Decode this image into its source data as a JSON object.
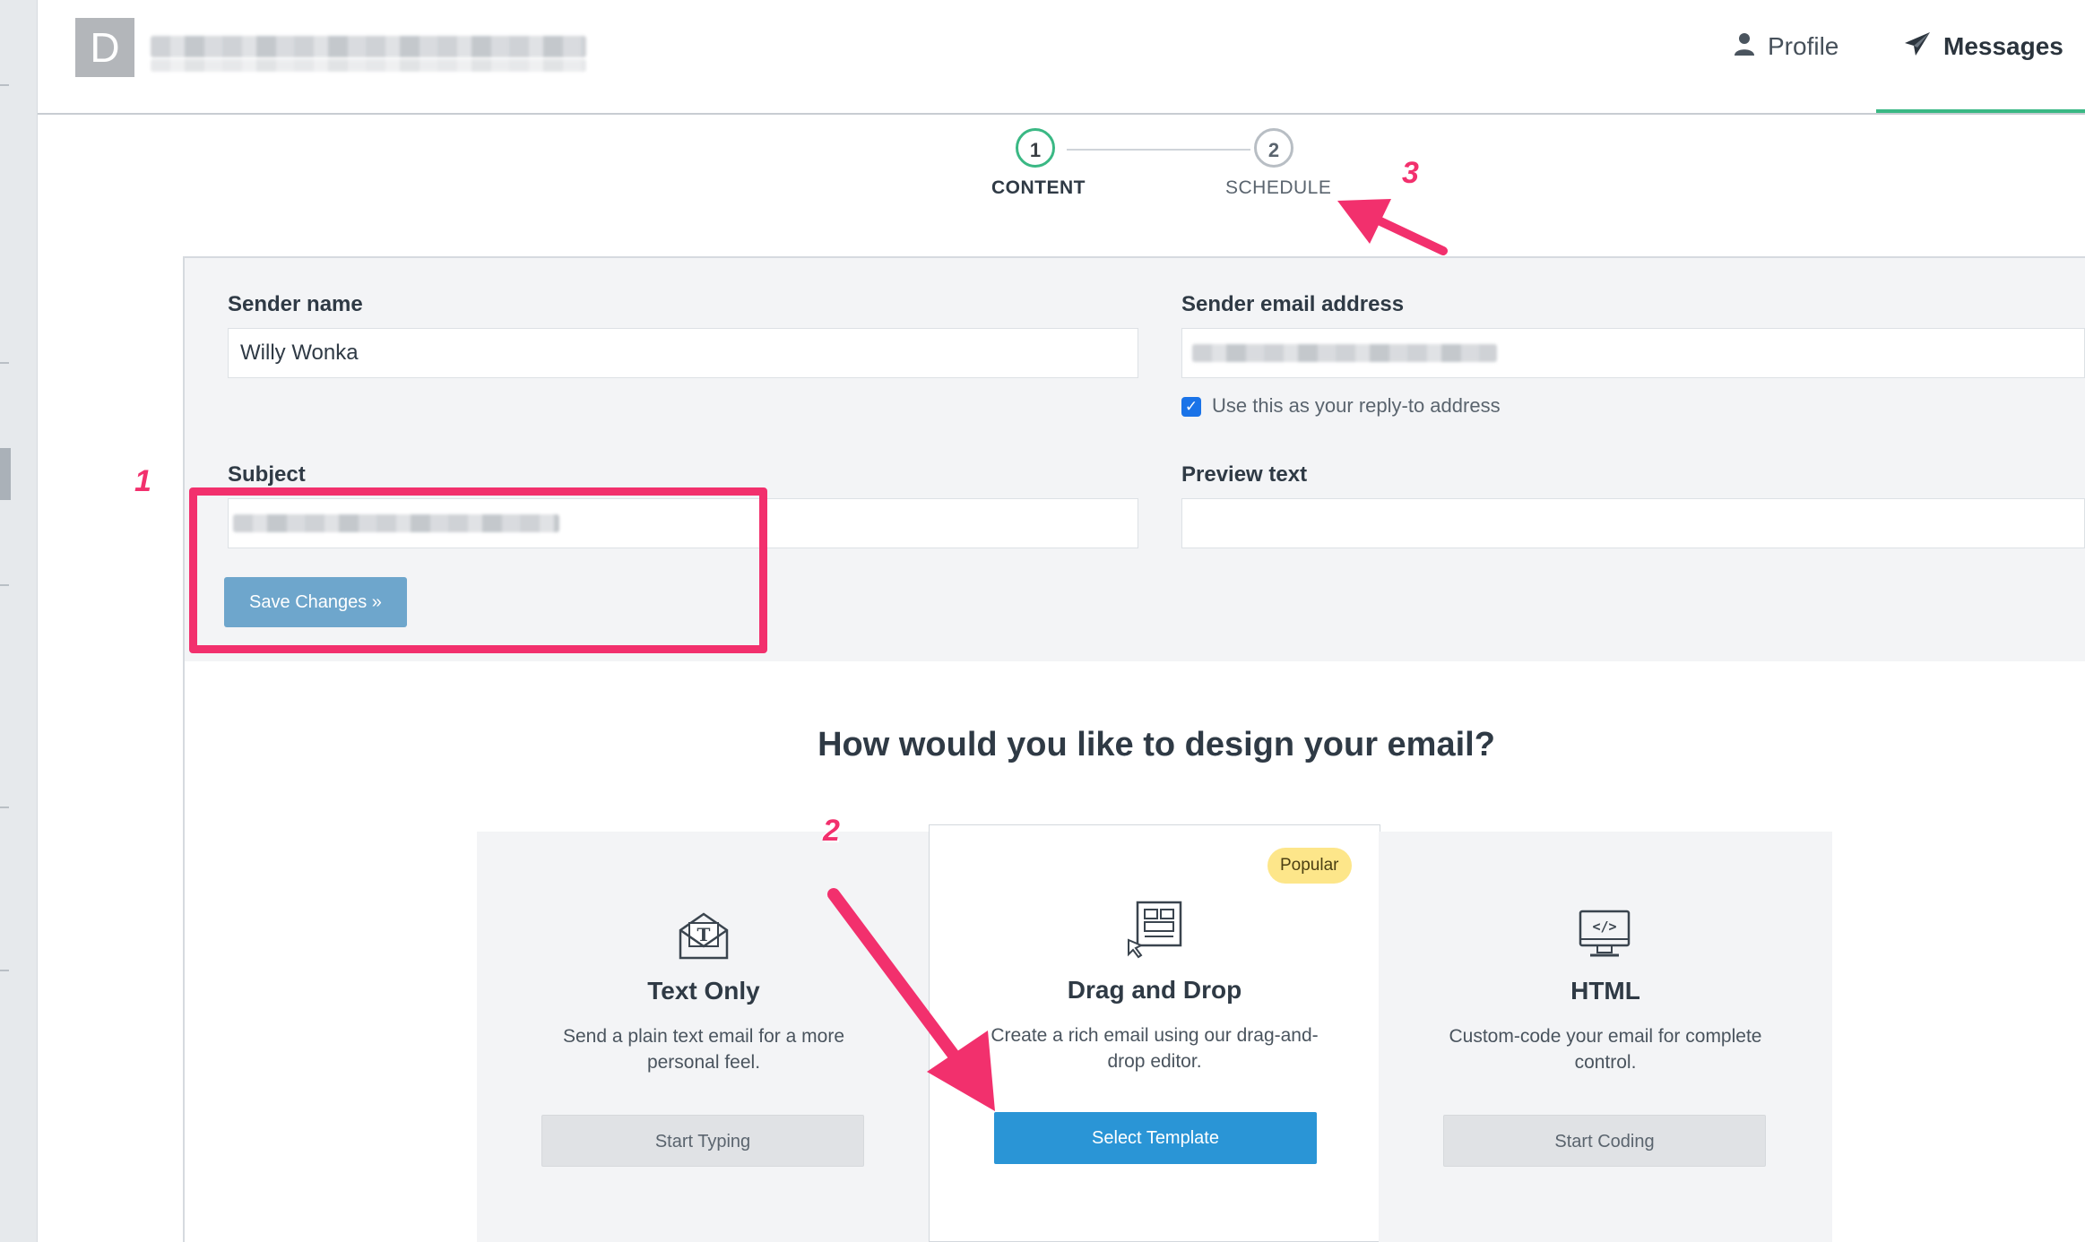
{
  "header": {
    "logo_letter": "D",
    "nav": [
      {
        "label": "Profile",
        "icon": "user-icon"
      },
      {
        "label": "Messages",
        "icon": "paper-plane-icon"
      }
    ]
  },
  "stepper": {
    "steps": [
      {
        "number": "1",
        "label": "CONTENT",
        "state": "active"
      },
      {
        "number": "2",
        "label": "SCHEDULE",
        "state": "inactive"
      }
    ]
  },
  "form": {
    "sender_name": {
      "label": "Sender name",
      "value": "Willy Wonka"
    },
    "sender_email": {
      "label": "Sender email address",
      "value": ""
    },
    "reply_to": {
      "label": "Use this as your reply-to address",
      "checked": true
    },
    "subject": {
      "label": "Subject",
      "value": ""
    },
    "preview_text": {
      "label": "Preview text",
      "value": ""
    },
    "save_label": "Save Changes »"
  },
  "design": {
    "question": "How would you like to design your email?",
    "cards": [
      {
        "icon": "text-envelope-icon",
        "title": "Text Only",
        "desc_line1": "Send a plain text email for a more",
        "desc_line2": "personal feel.",
        "button": "Start Typing"
      },
      {
        "icon": "drag-drop-layout-icon",
        "title": "Drag and Drop",
        "desc_line1": "Create a rich email using our drag-and-",
        "desc_line2": "drop editor.",
        "button": "Select Template",
        "badge": "Popular"
      },
      {
        "icon": "code-monitor-icon",
        "title": "HTML",
        "desc_line1": "Custom-code your email for complete",
        "desc_line2": "control.",
        "button": "Start Coding"
      }
    ]
  },
  "annotations": {
    "marker_1": "1",
    "marker_2": "2",
    "marker_3": "3",
    "color": "#f2306d"
  },
  "colors": {
    "accent_green": "#3ab884",
    "primary_blue": "#2a95d6",
    "save_button": "#6ea6cc",
    "badge_yellow": "#fde68a"
  }
}
